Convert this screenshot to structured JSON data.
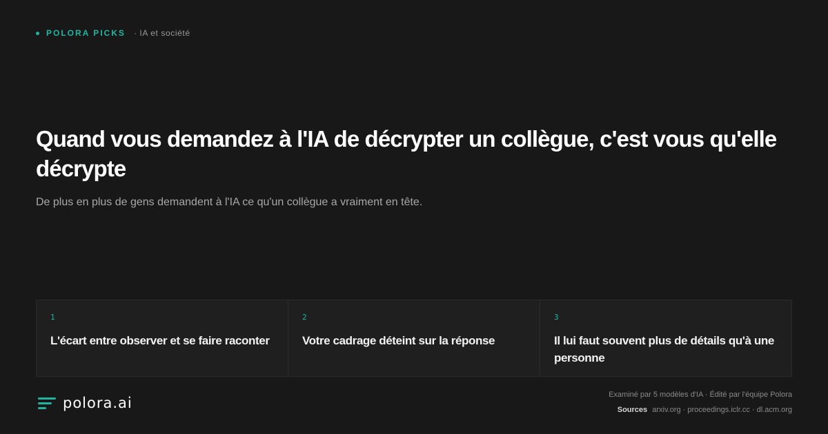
{
  "header": {
    "brand": "POLORA PICKS",
    "category": "· IA et société"
  },
  "article": {
    "title": "Quand vous demandez à l'IA de décrypter un collègue, c'est vous qu'elle décrypte",
    "subtitle": "De plus en plus de gens demandent à l'IA ce qu'un collègue a vraiment en tête."
  },
  "points": [
    {
      "number": "1",
      "text": "L'écart entre observer et se faire raconter"
    },
    {
      "number": "2",
      "text": "Votre cadrage déteint sur la réponse"
    },
    {
      "number": "3",
      "text": "Il lui faut souvent plus de détails qu'à une personne"
    }
  ],
  "footer": {
    "logo_text": "polora.ai",
    "review_line": "Examiné par 5 modèles d'IA · Édité par l'équipe Polora",
    "sources_label": "Sources",
    "sources_list": "arxiv.org · proceedings.iclr.cc · dl.acm.org"
  },
  "colors": {
    "background": "#181818",
    "accent": "#1fb5a0",
    "card_background": "#1f1f1f"
  },
  "icons": {
    "logo": "polora-logo-icon",
    "bullet": "dot-icon"
  }
}
